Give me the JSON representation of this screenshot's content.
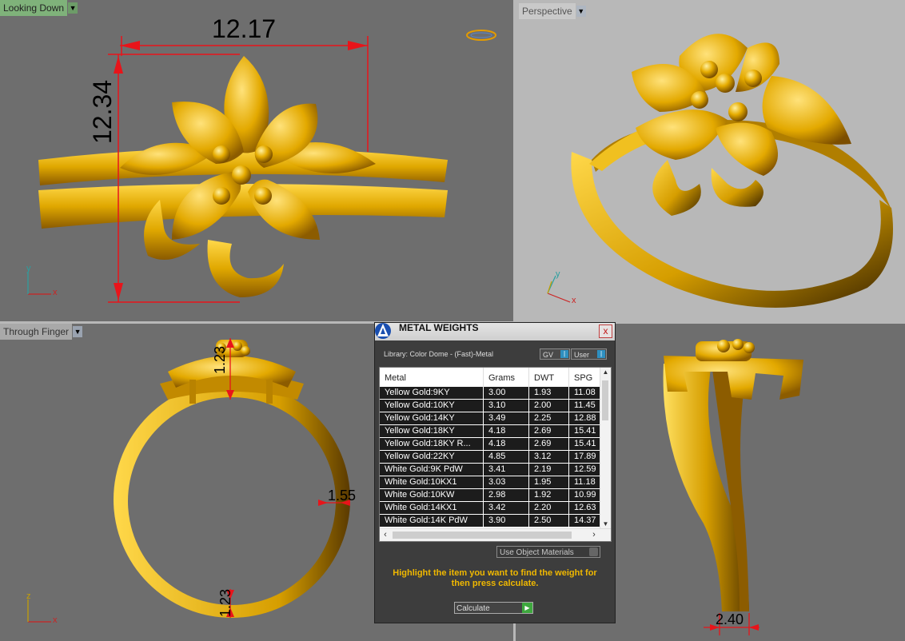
{
  "viewports": {
    "top_left": {
      "label": "Looking Down",
      "dim_horizontal": "12.17",
      "dim_vertical": "12.34",
      "axis_x": "x",
      "axis_y": "y"
    },
    "top_right": {
      "label": "Perspective",
      "axis_x": "x",
      "axis_y": "y"
    },
    "bottom_left": {
      "label": "Through Finger",
      "dim_top": "1.23",
      "dim_side": "1.55",
      "dim_bottom": "1.23",
      "axis_x": "x",
      "axis_y": "z"
    },
    "bottom_right": {
      "dim_bottom": "2.40"
    }
  },
  "dialog": {
    "title": "METAL WEIGHTS",
    "close_label": "x",
    "library": "Library: Color Dome - (Fast)-Metal",
    "toggle_gv": "GV",
    "toggle_user": "User",
    "columns": [
      "Metal",
      "Grams",
      "DWT",
      "SPG"
    ],
    "rows": [
      {
        "metal": "Yellow Gold:9KY",
        "grams": "3.00",
        "dwt": "1.93",
        "spg": "11.08"
      },
      {
        "metal": "Yellow Gold:10KY",
        "grams": "3.10",
        "dwt": "2.00",
        "spg": "11.45"
      },
      {
        "metal": "Yellow Gold:14KY",
        "grams": "3.49",
        "dwt": "2.25",
        "spg": "12.88"
      },
      {
        "metal": "Yellow Gold:18KY",
        "grams": "4.18",
        "dwt": "2.69",
        "spg": "15.41"
      },
      {
        "metal": "Yellow Gold:18KY R...",
        "grams": "4.18",
        "dwt": "2.69",
        "spg": "15.41"
      },
      {
        "metal": "Yellow Gold:22KY",
        "grams": "4.85",
        "dwt": "3.12",
        "spg": "17.89"
      },
      {
        "metal": "White Gold:9K PdW",
        "grams": "3.41",
        "dwt": "2.19",
        "spg": "12.59"
      },
      {
        "metal": "White Gold:10KX1",
        "grams": "3.03",
        "dwt": "1.95",
        "spg": "11.18"
      },
      {
        "metal": "White Gold:10KW",
        "grams": "2.98",
        "dwt": "1.92",
        "spg": "10.99"
      },
      {
        "metal": "White Gold:14KX1",
        "grams": "3.42",
        "dwt": "2.20",
        "spg": "12.63"
      },
      {
        "metal": "White Gold:14K PdW",
        "grams": "3.90",
        "dwt": "2.50",
        "spg": "14.37"
      }
    ],
    "use_object_materials": "Use Object Materials",
    "hint": "Highlight the item you want to find the weight for then press calculate.",
    "calculate": "Calculate"
  },
  "colors": {
    "gold": "#e0a800",
    "dim_red": "#e8141a",
    "viewport_bg": "#6e6e6e",
    "perspective_bg": "#b8b8b8"
  }
}
